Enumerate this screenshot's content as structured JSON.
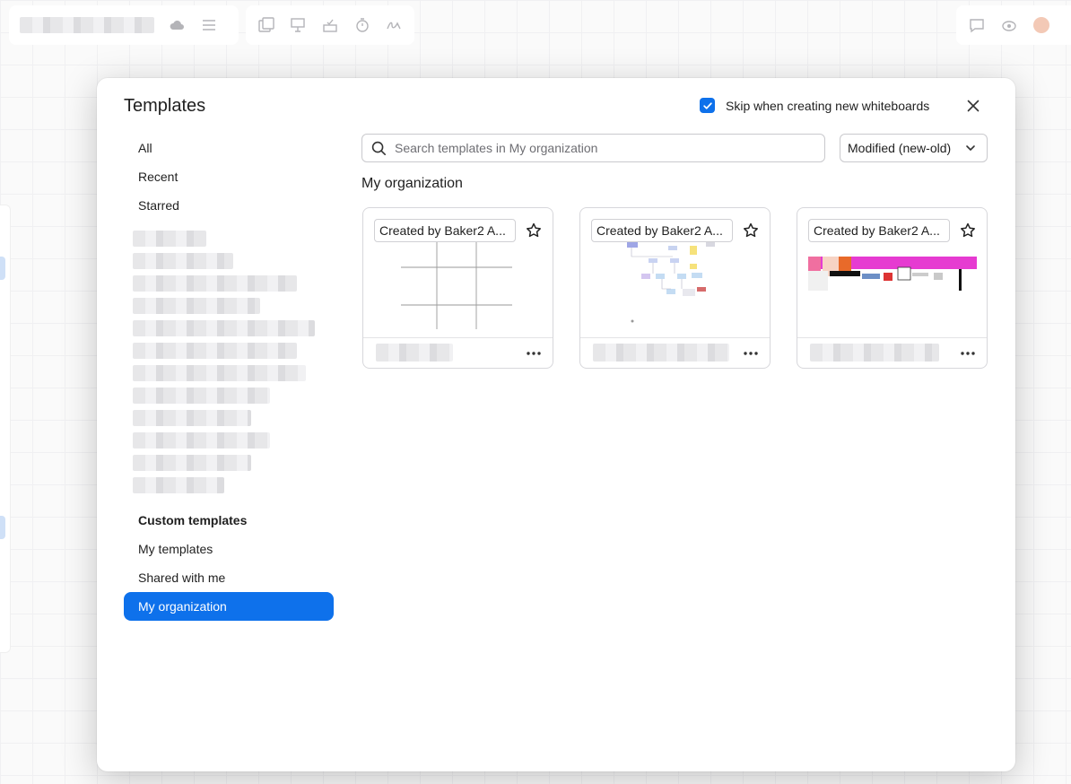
{
  "modal": {
    "title": "Templates",
    "skip_label": "Skip when creating new whiteboards",
    "skip_checked": true,
    "close_icon": "close-icon"
  },
  "nav": {
    "items": [
      {
        "label": "All"
      },
      {
        "label": "Recent"
      },
      {
        "label": "Starred"
      }
    ],
    "custom_heading": "Custom templates",
    "custom_items": [
      {
        "label": "My templates"
      },
      {
        "label": "Shared with me"
      },
      {
        "label": "My organization",
        "active": true
      }
    ]
  },
  "search": {
    "placeholder": "Search templates in My organization",
    "value": ""
  },
  "sort": {
    "selected": "Modified (new-old)"
  },
  "section": {
    "title": "My organization"
  },
  "cards": [
    {
      "tag": "Created by Baker2 A...",
      "thumb": "grid-thumbnail"
    },
    {
      "tag": "Created by Baker2 A...",
      "thumb": "flowchart-thumbnail"
    },
    {
      "tag": "Created by Baker2 A...",
      "thumb": "banner-thumbnail"
    }
  ],
  "colors": {
    "accent": "#0e71eb",
    "magenta": "#e63bd1"
  }
}
